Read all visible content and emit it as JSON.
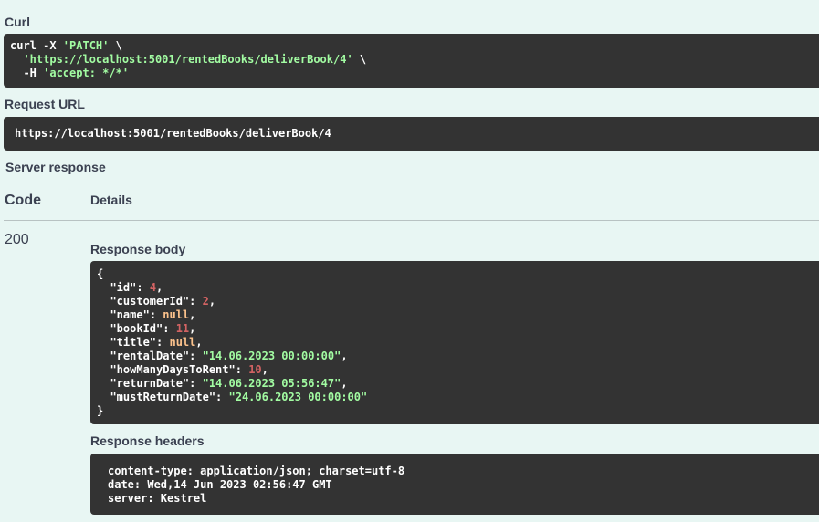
{
  "curl": {
    "label": "Curl",
    "line1_prefix": "curl -X ",
    "line1_method": "'PATCH'",
    "line1_suffix": " \\",
    "line2_url": "'https://localhost:5001/rentedBooks/deliverBook/4'",
    "line2_suffix": " \\",
    "line3_prefix": "  -H ",
    "line3_header": "'accept: */*'"
  },
  "request_url": {
    "label": "Request URL",
    "value": "https://localhost:5001/rentedBooks/deliverBook/4"
  },
  "server_response": {
    "label": "Server response",
    "code_header": "Code",
    "details_header": "Details",
    "code": "200",
    "body_label": "Response body",
    "body": {
      "open": "{",
      "close": "}",
      "fields": [
        {
          "key": "\"id\"",
          "value": "4",
          "kind": "num"
        },
        {
          "key": "\"customerId\"",
          "value": "2",
          "kind": "num"
        },
        {
          "key": "\"name\"",
          "value": "null",
          "kind": "nul"
        },
        {
          "key": "\"bookId\"",
          "value": "11",
          "kind": "num"
        },
        {
          "key": "\"title\"",
          "value": "null",
          "kind": "nul"
        },
        {
          "key": "\"rentalDate\"",
          "value": "\"14.06.2023 00:00:00\"",
          "kind": "str"
        },
        {
          "key": "\"howManyDaysToRent\"",
          "value": "10",
          "kind": "num"
        },
        {
          "key": "\"returnDate\"",
          "value": "\"14.06.2023 05:56:47\"",
          "kind": "str"
        },
        {
          "key": "\"mustReturnDate\"",
          "value": "\"24.06.2023 00:00:00\"",
          "kind": "str"
        }
      ]
    },
    "headers_label": "Response headers",
    "headers": [
      "content-type: application/json; charset=utf-8",
      "date: Wed,14 Jun 2023 02:56:47 GMT",
      "server: Kestrel"
    ]
  }
}
